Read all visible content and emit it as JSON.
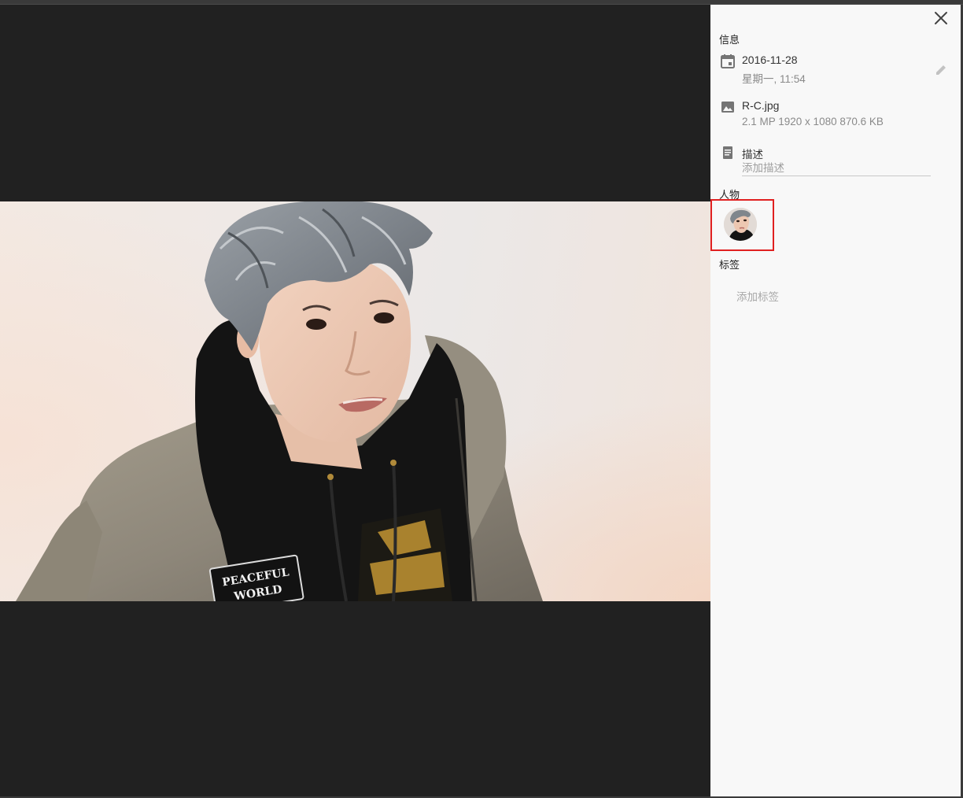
{
  "panel": {
    "info_title": "信息",
    "date": "2016-11-28",
    "weekday_time": "星期一, 11:54",
    "file_name": "R-C.jpg",
    "file_details": "2.1 MP  1920 x 1080  870.6 KB",
    "description_label": "描述",
    "description_placeholder": "添加描述",
    "people_title": "人物",
    "tags_title": "标签",
    "add_tag": "添加标签"
  },
  "photo": {
    "patch_text_line1": "PEACEFUL",
    "patch_text_line2": "WORLD"
  },
  "icons": {
    "close": "close-icon",
    "calendar": "calendar-icon",
    "image": "image-icon",
    "description": "description-icon",
    "edit": "pencil-icon"
  },
  "colors": {
    "viewer_bg": "#212121",
    "panel_bg": "#f8f8f8",
    "highlight": "#e02020"
  }
}
